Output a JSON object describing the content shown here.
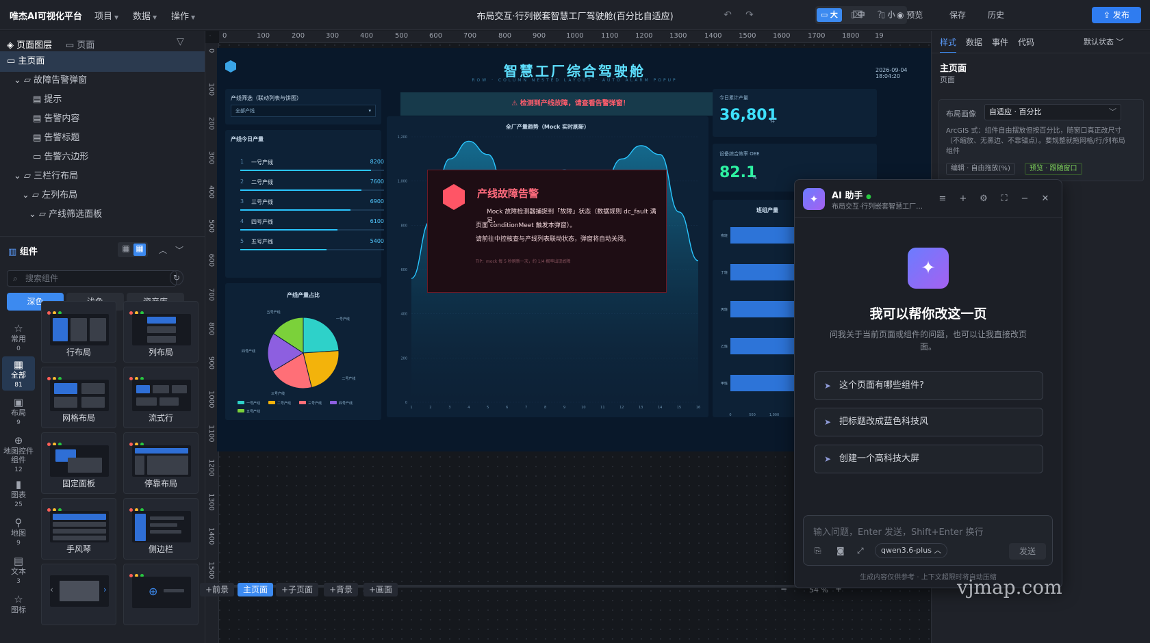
{
  "topbar": {
    "brand": "唯杰AI可视化平台",
    "menus": [
      "项目",
      "数据",
      "操作"
    ],
    "doc_title": "布局交互·行列嵌套智慧工厂驾驶舱(百分比自适应)",
    "sizes": [
      "大",
      "中",
      "小"
    ],
    "preview": "预览",
    "save": "保存",
    "history": "历史",
    "publish": "发布"
  },
  "left": {
    "tabs": [
      "页面图层",
      "页面"
    ],
    "tree": [
      {
        "label": "主页面",
        "level": 0
      },
      {
        "label": "故障告警弹窗",
        "level": 1
      },
      {
        "label": "提示",
        "level": 2
      },
      {
        "label": "告警内容",
        "level": 2
      },
      {
        "label": "告警标题",
        "level": 2
      },
      {
        "label": "告警六边形",
        "level": 2
      },
      {
        "label": "三栏行布局",
        "level": 1
      },
      {
        "label": "左列布局",
        "level": 2
      },
      {
        "label": "产线筛选面板",
        "level": 3
      }
    ],
    "components_title": "组件",
    "search_placeholder": "搜索组件",
    "themes": [
      "深色",
      "浅色",
      "资产库"
    ],
    "rail": [
      {
        "label": "常用",
        "count": "0"
      },
      {
        "label": "全部",
        "count": "81"
      },
      {
        "label": "布局",
        "count": "9"
      },
      {
        "label": "地图控件组件",
        "count": "12"
      },
      {
        "label": "图表",
        "count": "25"
      },
      {
        "label": "地图",
        "count": "9"
      },
      {
        "label": "文本",
        "count": "3"
      },
      {
        "label": "图标",
        "count": ""
      }
    ],
    "cards": [
      "行布局",
      "列布局",
      "网格布局",
      "流式行",
      "固定面板",
      "停靠布局",
      "手风琴",
      "侧边栏",
      "",
      ""
    ]
  },
  "canvas": {
    "ruler_x": [
      "0",
      "100",
      "200",
      "300",
      "400",
      "500",
      "600",
      "700",
      "800",
      "900",
      "1000",
      "1100",
      "1200",
      "1300",
      "1400",
      "1500",
      "1600",
      "1700",
      "1800",
      "19"
    ],
    "ruler_y": [
      "0",
      "100",
      "200",
      "300",
      "400",
      "500",
      "600",
      "700",
      "800",
      "900",
      "1000",
      "1100",
      "1200",
      "1300",
      "1400",
      "1500"
    ],
    "bottom_tabs": [
      "+前景",
      "主页面",
      "+子页面",
      "+背景",
      "+画面"
    ],
    "zoom": "54 %"
  },
  "dashboard": {
    "title": "智慧工厂综合驾驶舱",
    "subtitle": "ROW · COLUMN NESTED LAYOUT · AUTO ALARM POPUP",
    "date": "2026-09-04 18:04:20",
    "filter_label": "产线筛选（联动列表与饼图）",
    "filter_value": "全部产线",
    "output_title": "产线今日产量",
    "lines": [
      {
        "no": "1",
        "name": "一号产线",
        "value": 8200
      },
      {
        "no": "2",
        "name": "二号产线",
        "value": 7600
      },
      {
        "no": "3",
        "name": "三号产线",
        "value": 6900
      },
      {
        "no": "4",
        "name": "四号产线",
        "value": 6100
      },
      {
        "no": "5",
        "name": "五号产线",
        "value": 5400
      }
    ],
    "pie_title": "产线产量占比",
    "warning": "⚠ 检测到产线故障，请查看告警弹窗！",
    "area_title": "全厂产量趋势（Mock 实时刷新）",
    "kpi1_label": "今日累计产量",
    "kpi1_value": "36,801",
    "kpi1_unit": "件",
    "kpi2_label": "设备综合效率 OEE",
    "kpi2_value": "82.1",
    "kpi2_unit": "%",
    "hbar_title": "班组产量",
    "hbar_labels": [
      "甲班",
      "乙班",
      "丙班",
      "丁班",
      "夜班"
    ],
    "alarm_title": "产线故障告警",
    "alarm_lines": [
      "Mock 故障检测器捕捉到「故障」状态（数据规则 dc_fault 满足，",
      "页面 conditionMeet 触发本弹窗）。",
      "请前往中控核查与产线列表联动状态，弹窗将自动关闭。"
    ],
    "alarm_tip": "TIP：mock 每 5 秒刷新一次，约 1/4 概率出现故障"
  },
  "chart_data": [
    {
      "type": "bar",
      "title": "产线今日产量",
      "categories": [
        "一号产线",
        "二号产线",
        "三号产线",
        "四号产线",
        "五号产线"
      ],
      "values": [
        8200,
        7600,
        6900,
        6100,
        5400
      ]
    },
    {
      "type": "pie",
      "title": "产线产量占比",
      "categories": [
        "一号产线",
        "二号产线",
        "三号产线",
        "四号产线",
        "五号产线"
      ],
      "values": [
        8200,
        7600,
        6900,
        6100,
        5400
      ],
      "colors": [
        "#2ed1c9",
        "#f3b30b",
        "#ff6f77",
        "#8d5fe0",
        "#7bd13a"
      ]
    },
    {
      "type": "area",
      "title": "全厂产量趋势（Mock 实时刷新）",
      "x": [
        1,
        2,
        3,
        4,
        5,
        6,
        7,
        8,
        9,
        10,
        11,
        12,
        13,
        14,
        15,
        16
      ],
      "y": [
        560,
        820,
        1100,
        1180,
        1120,
        930,
        900,
        1000,
        1050,
        1000,
        980,
        1100,
        1160,
        1120,
        860,
        640
      ],
      "ylim": [
        0,
        1200
      ],
      "yticks": [
        "0",
        "200",
        "400",
        "600",
        "800",
        "1,000",
        "1,200"
      ]
    },
    {
      "type": "bar",
      "title": "班组产量",
      "categories": [
        "甲班",
        "乙班",
        "丙班",
        "丁班",
        "夜班"
      ],
      "values": [
        1900,
        1800,
        1750,
        1850,
        1900
      ],
      "xticks": [
        "0",
        "500",
        "1,000"
      ]
    }
  ],
  "right": {
    "tabs": [
      "样式",
      "数据",
      "事件",
      "代码"
    ],
    "state": "默认状态",
    "heading": "主页面",
    "heading_sub": "页面",
    "layout_label": "布局画像",
    "layout_value": "自适应 · 百分比",
    "desc": "ArcGIS 式：组件自由摆放但按百分比，随窗口真正改尺寸（不缩放、无黑边、不靠锚点）。要规整就拖网格/行/列布局组件",
    "tag_edit": "编辑 · 自由拖放(%)",
    "tag_preview": "预览 · 跟随窗口"
  },
  "ai": {
    "title": "AI 助手",
    "subtitle": "布局交互·行列嵌套智慧工厂…",
    "headline": "我可以帮你改这一页",
    "intro": "问我关于当前页面或组件的问题，也可以让我直接改页面。",
    "suggestions": [
      "这个页面有哪些组件?",
      "把标题改成蓝色科技风",
      "创建一个高科技大屏"
    ],
    "input_placeholder": "输入问题，Enter 发送，Shift+Enter 换行",
    "model": "qwen3.6-plus",
    "send": "发送",
    "footer": "生成内容仅供参考 · 上下文超限时将自动压缩"
  },
  "watermark": "vjmap.com"
}
